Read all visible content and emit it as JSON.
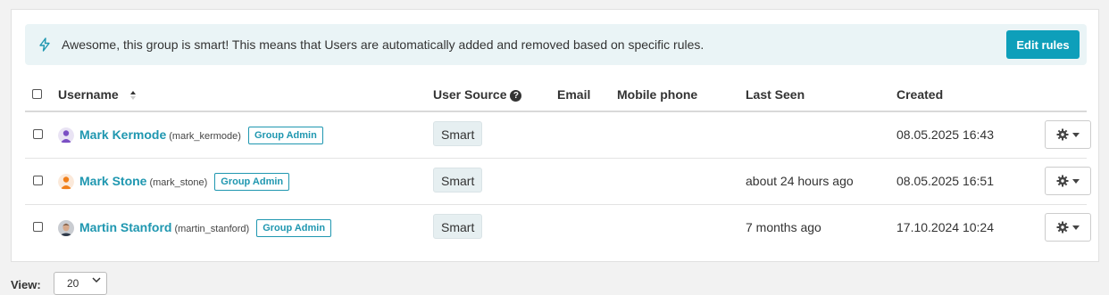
{
  "banner": {
    "icon": "bolt-icon",
    "text": "Awesome, this group is smart! This means that Users are automatically added and removed based on specific rules.",
    "button_label": "Edit rules"
  },
  "table": {
    "headers": {
      "username": "Username",
      "user_source": "User Source",
      "email": "Email",
      "mobile": "Mobile phone",
      "last_seen": "Last Seen",
      "created": "Created"
    },
    "rows": [
      {
        "name": "Mark Kermode",
        "login": "(mark_kermode)",
        "badge": "Group Admin",
        "source": "Smart",
        "email": "",
        "mobile": "",
        "last_seen": "",
        "created": "08.05.2025 16:43"
      },
      {
        "name": "Mark Stone",
        "login": "(mark_stone)",
        "badge": "Group Admin",
        "source": "Smart",
        "email": "",
        "mobile": "",
        "last_seen": "about 24 hours ago",
        "created": "08.05.2025 16:51"
      },
      {
        "name": "Martin Stanford",
        "login": "(martin_stanford)",
        "badge": "Group Admin",
        "source": "Smart",
        "email": "",
        "mobile": "",
        "last_seen": "7 months ago",
        "created": "17.10.2024 10:24"
      }
    ]
  },
  "footer": {
    "view_label": "View:",
    "view_value": "20"
  },
  "colors": {
    "accent": "#0e9fba",
    "link": "#1f97b0",
    "banner_bg": "#eaf4f6"
  }
}
